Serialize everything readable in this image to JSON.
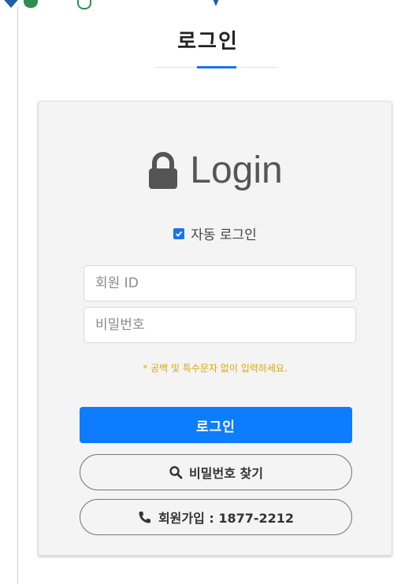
{
  "page": {
    "title": "로그인"
  },
  "login_box": {
    "heading": "Login",
    "heading_icon": "lock-icon",
    "auto_login": {
      "label": "자동 로그인",
      "checked": true
    },
    "user_id": {
      "placeholder": "회원 ID"
    },
    "password": {
      "placeholder": "비밀번호"
    },
    "notice": "* 공백 및 특수문자 없이 입력하세요.",
    "login_button": "로그인",
    "find_password_button": {
      "icon": "search-icon",
      "label": "비밀번호 찾기"
    },
    "signup_button": {
      "icon": "phone-icon",
      "label": "회원가입 : 1877-2212"
    }
  },
  "colors": {
    "accent": "#1a73e8",
    "primary_button": "#0d7cff",
    "notice": "#e0a800",
    "card_background": "#f4f4f4"
  }
}
